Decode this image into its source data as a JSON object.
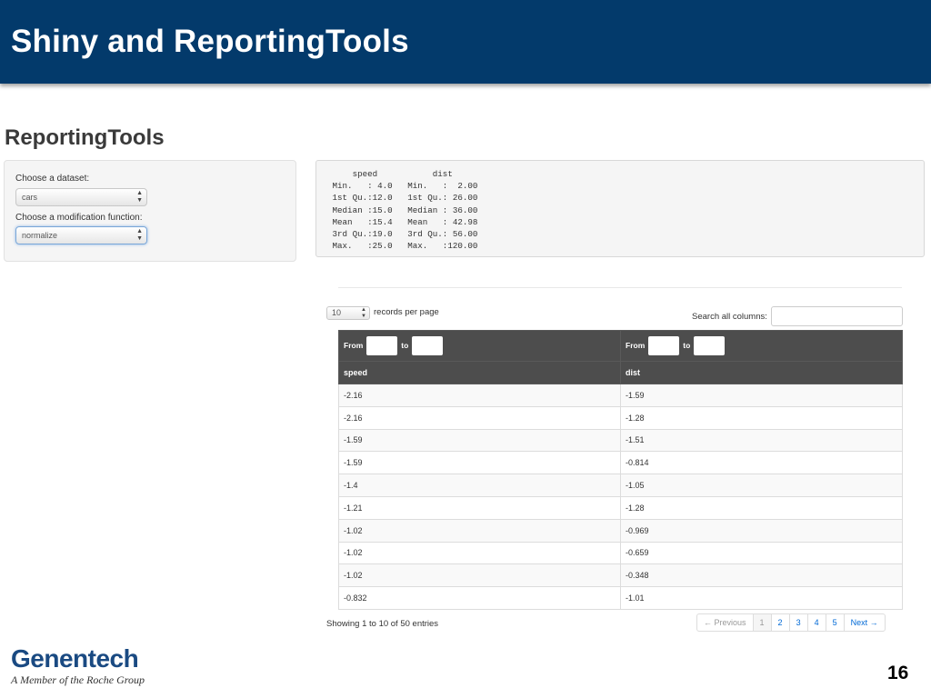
{
  "slide": {
    "title": "Shiny and ReportingTools",
    "page_number": "16",
    "brand_color": "#033a6b"
  },
  "app": {
    "title": "ReportingTools",
    "sidebar": {
      "dataset_label": "Choose a dataset:",
      "dataset_value": "cars",
      "function_label": "Choose a modification function:",
      "function_value": "normalize"
    },
    "summary_text": "     speed           dist       \n Min.   : 4.0   Min.   :  2.00  \n 1st Qu.:12.0   1st Qu.: 26.00  \n Median :15.0   Median : 36.00  \n Mean   :15.4   Mean   : 42.98  \n 3rd Qu.:19.0   3rd Qu.: 56.00  \n Max.   :25.0   Max.   :120.00  "
  },
  "table_controls": {
    "length_value": "10",
    "length_label": "records per page",
    "search_label": "Search all columns:",
    "search_value": ""
  },
  "filters": {
    "from_label": "From",
    "to_label": "to"
  },
  "table": {
    "columns": [
      "speed",
      "dist"
    ],
    "rows": [
      [
        "-2.16",
        "-1.59"
      ],
      [
        "-2.16",
        "-1.28"
      ],
      [
        "-1.59",
        "-1.51"
      ],
      [
        "-1.59",
        "-0.814"
      ],
      [
        "-1.4",
        "-1.05"
      ],
      [
        "-1.21",
        "-1.28"
      ],
      [
        "-1.02",
        "-0.969"
      ],
      [
        "-1.02",
        "-0.659"
      ],
      [
        "-1.02",
        "-0.348"
      ],
      [
        "-0.832",
        "-1.01"
      ]
    ]
  },
  "footer": {
    "info": "Showing 1 to 10 of 50 entries",
    "pagination": {
      "previous": "← Previous",
      "pages": [
        "1",
        "2",
        "3",
        "4",
        "5"
      ],
      "active_page": "1",
      "next": "Next →"
    }
  },
  "logo": {
    "brand": "Genentech",
    "tagline": "A Member of the Roche Group"
  }
}
